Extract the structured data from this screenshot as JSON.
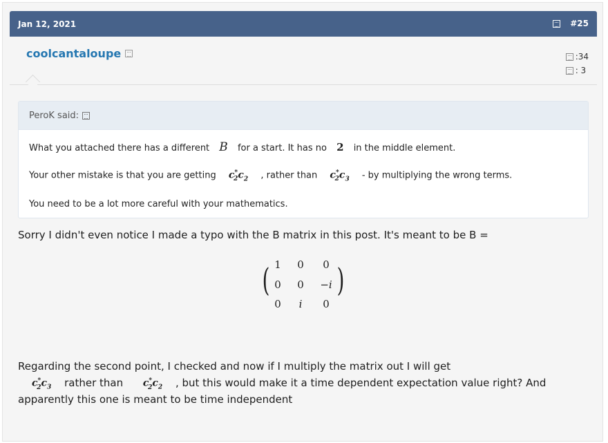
{
  "post": {
    "date": "Jan 12, 2021",
    "number": "#25",
    "share_icon": "share-icon",
    "bookmark_icon": "bookmark-icon"
  },
  "user": {
    "name": "coolcantaloupe",
    "badge_icon": "user-badge-icon",
    "stats": [
      {
        "icon": "messages-icon",
        "value": ":34"
      },
      {
        "icon": "reaction-icon",
        "value": ":  3"
      }
    ]
  },
  "quote": {
    "author": "PeroK said:",
    "line1": {
      "a": "What you attached there has a different",
      "m1": "B",
      "b": "for a start. It has no",
      "m2": "2",
      "c": "in the middle element."
    },
    "line2": {
      "a": "Your other mistake is that you are getting",
      "m1": "c*2c2",
      "b": ", rather than",
      "m2": "c*2c3",
      "c": "- by multiplying the wrong terms."
    },
    "line3": "You need to be a lot more careful with your mathematics."
  },
  "reply": {
    "para1": "Sorry I didn't even notice I made a typo with the B matrix in this post. It's meant to be B =",
    "matrix": [
      [
        "1",
        "0",
        "0"
      ],
      [
        "0",
        "0",
        "−i"
      ],
      [
        "0",
        "i",
        "0"
      ]
    ],
    "para2_line1": "Regarding the second point, I checked and now if I multiply the matrix out I will get",
    "para2_line2_mid": "rather than",
    "para2_line2_end": ", but this would make it a time dependent expectation value right? And",
    "para2_line3": "apparently this one is meant to be time independent",
    "expr1": "c*2c3",
    "expr2": "c*2c2"
  },
  "colors": {
    "header": "#47628a",
    "username": "#2577b1",
    "quote_head": "#e7edf3"
  }
}
